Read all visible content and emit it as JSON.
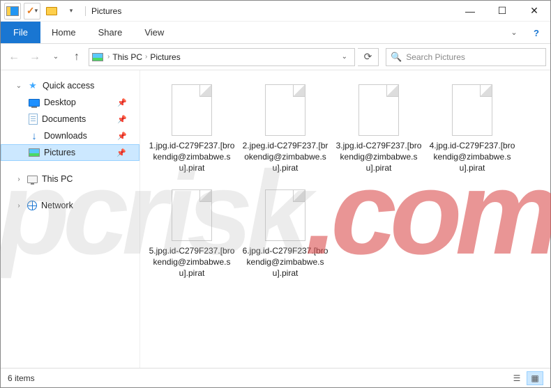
{
  "titlebar": {
    "title": "Pictures"
  },
  "ribbon": {
    "file": "File",
    "tabs": [
      "Home",
      "Share",
      "View"
    ]
  },
  "nav": {
    "breadcrumb": [
      "This PC",
      "Pictures"
    ],
    "search_placeholder": "Search Pictures"
  },
  "sidebar": {
    "quick_access": "Quick access",
    "items": [
      {
        "label": "Desktop",
        "pinned": true
      },
      {
        "label": "Documents",
        "pinned": true
      },
      {
        "label": "Downloads",
        "pinned": true
      },
      {
        "label": "Pictures",
        "pinned": true,
        "selected": true
      }
    ],
    "this_pc": "This PC",
    "network": "Network"
  },
  "files": [
    {
      "name": "1.jpg.id-C279F237.[brokendig@zimbabwe.su].pirat"
    },
    {
      "name": "2.jpeg.id-C279F237.[brokendig@zimbabwe.su].pirat"
    },
    {
      "name": "3.jpg.id-C279F237.[brokendig@zimbabwe.su].pirat"
    },
    {
      "name": "4.jpg.id-C279F237.[brokendig@zimbabwe.su].pirat"
    },
    {
      "name": "5.jpg.id-C279F237.[brokendig@zimbabwe.su].pirat"
    },
    {
      "name": "6.jpg.id-C279F237.[brokendig@zimbabwe.su].pirat"
    }
  ],
  "statusbar": {
    "count": "6 items"
  },
  "watermark": {
    "text_plain": "pcrisk",
    "text_dot": ".com"
  }
}
